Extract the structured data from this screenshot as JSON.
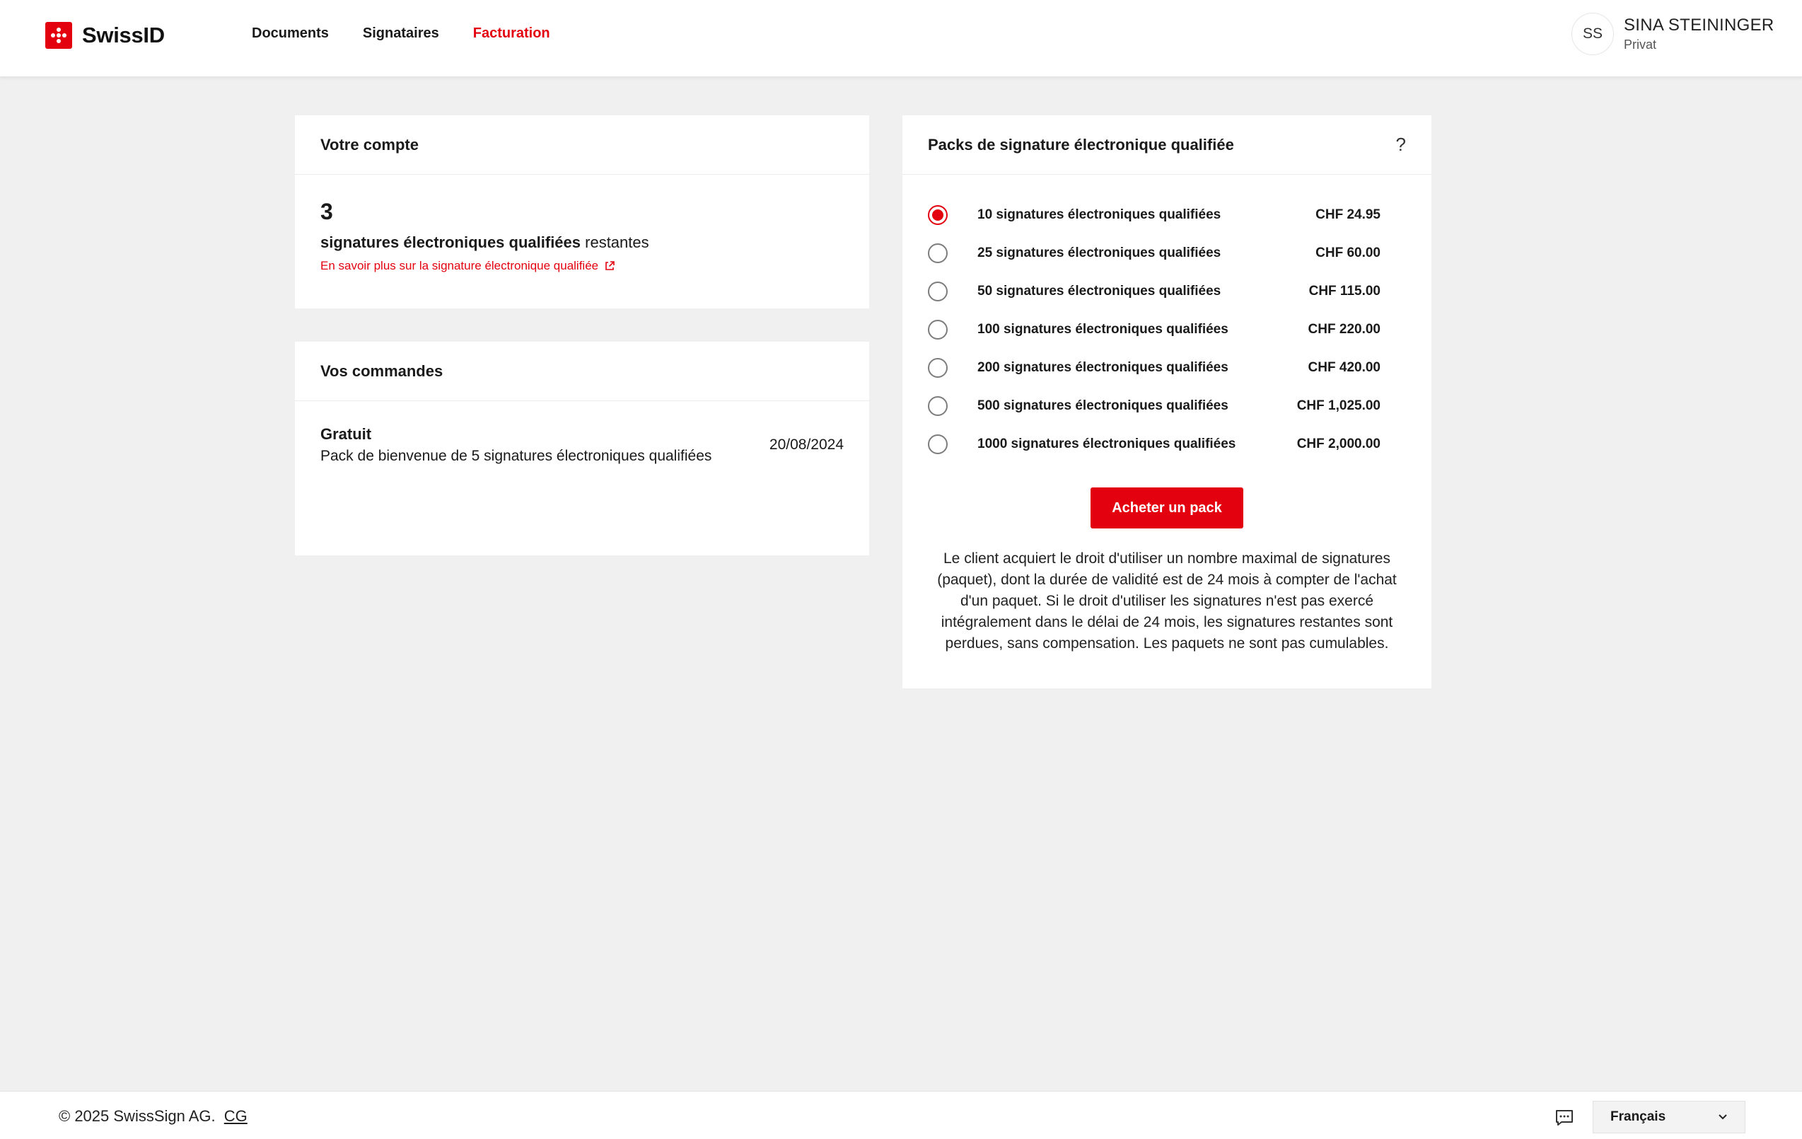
{
  "header": {
    "brand": "SwissID",
    "nav": [
      {
        "label": "Documents",
        "active": false
      },
      {
        "label": "Signataires",
        "active": false
      },
      {
        "label": "Facturation",
        "active": true
      }
    ],
    "user": {
      "initials": "SS",
      "name": "SINA STEININGER",
      "account_type": "Privat"
    }
  },
  "account": {
    "title": "Votre compte",
    "remaining_count": "3",
    "remaining_bold": "signatures électroniques qualifiées",
    "remaining_suffix": " restantes",
    "learn_more": "En savoir plus sur la signature électronique qualifiée"
  },
  "orders": {
    "title": "Vos commandes",
    "items": [
      {
        "type": "Gratuit",
        "description": "Pack de bienvenue de 5 signatures électroniques qualifiées",
        "date": "20/08/2024"
      }
    ]
  },
  "packs": {
    "title": "Packs de signature électronique qualifiée",
    "help": "?",
    "selected_index": 0,
    "options": [
      {
        "label": "10 signatures électroniques qualifiées",
        "price": "CHF 24.95"
      },
      {
        "label": "25 signatures électroniques qualifiées",
        "price": "CHF 60.00"
      },
      {
        "label": "50 signatures électroniques qualifiées",
        "price": "CHF 115.00"
      },
      {
        "label": "100 signatures électroniques qualifiées",
        "price": "CHF 220.00"
      },
      {
        "label": "200 signatures électroniques qualifiées",
        "price": "CHF 420.00"
      },
      {
        "label": "500 signatures électroniques qualifiées",
        "price": "CHF 1,025.00"
      },
      {
        "label": "1000 signatures électroniques qualifiées",
        "price": "CHF 2,000.00"
      }
    ],
    "buy_label": "Acheter un pack",
    "terms": "Le client acquiert le droit d'utiliser un nombre maximal de signatures (paquet), dont la durée de validité est de 24 mois à compter de l'achat d'un paquet. Si le droit d'utiliser les signatures n'est pas exercé intégralement dans le délai de 24 mois, les signatures restantes sont perdues, sans compensation. Les paquets ne sont pas cumulables."
  },
  "footer": {
    "copyright": "© 2025 SwissSign AG.",
    "cg_link": "CG",
    "language": "Français"
  },
  "colors": {
    "accent": "#e3000f",
    "background": "#f0f0f0",
    "card": "#ffffff"
  }
}
